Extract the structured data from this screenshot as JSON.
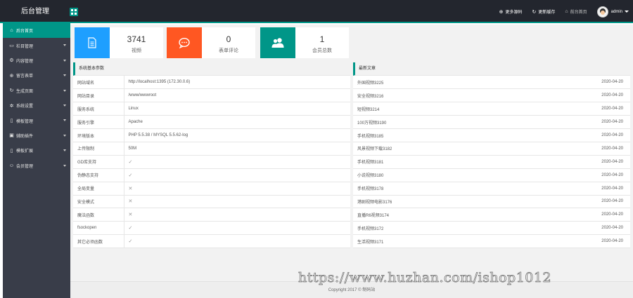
{
  "brand": {
    "title": "后台管理"
  },
  "topbar": {
    "links": [
      {
        "label": "更多源码",
        "icon": "globe-icon"
      },
      {
        "label": "更新缓存",
        "icon": "refresh-icon"
      },
      {
        "label": "前台首页",
        "icon": "home-icon"
      }
    ],
    "user": "admin"
  },
  "sidebar": {
    "items": [
      {
        "label": "后台首页",
        "icon": "home-icon",
        "active": true,
        "arrow": false
      },
      {
        "label": "栏目管理",
        "icon": "monitor-icon",
        "arrow": true
      },
      {
        "label": "内容管理",
        "icon": "settings-icon",
        "arrow": true
      },
      {
        "label": "留言表单",
        "icon": "globe-icon",
        "arrow": true
      },
      {
        "label": "生成页面",
        "icon": "refresh-icon",
        "arrow": true
      },
      {
        "label": "系统设置",
        "icon": "gear-icon",
        "arrow": true
      },
      {
        "label": "模板管理",
        "icon": "template-icon",
        "arrow": true
      },
      {
        "label": "辅助插件",
        "icon": "plugin-icon",
        "arrow": true
      },
      {
        "label": "模板扩展",
        "icon": "extend-icon",
        "arrow": true
      },
      {
        "label": "会员管理",
        "icon": "user-icon",
        "arrow": true
      }
    ]
  },
  "stats": [
    {
      "number": "3741",
      "label": "视频",
      "color": "#1e9fff",
      "icon": "document-icon"
    },
    {
      "number": "0",
      "label": "表单评论",
      "color": "#ff5722",
      "icon": "chat-icon"
    },
    {
      "number": "1",
      "label": "会员总数",
      "color": "#009688",
      "icon": "users-icon"
    }
  ],
  "system": {
    "title": "系统基本参数",
    "rows": [
      {
        "key": "网站域名",
        "value": "http://localhost:1395 (172.30.0.6)"
      },
      {
        "key": "网站目录",
        "value": "/www/wwwroot"
      },
      {
        "key": "服务系统",
        "value": "Linux"
      },
      {
        "key": "服务引擎",
        "value": "Apache"
      },
      {
        "key": "环境版本",
        "value": "PHP 5.5.38 / MYSQL 5.5.62-log"
      },
      {
        "key": "上传限制",
        "value": "50M"
      },
      {
        "key": "GD库支持",
        "value": "✓"
      },
      {
        "key": "伪静态支持",
        "value": "✓"
      },
      {
        "key": "全局变量",
        "value": "✕"
      },
      {
        "key": "安全模式",
        "value": "✕"
      },
      {
        "key": "魔法函数",
        "value": "✕"
      },
      {
        "key": "fsockopen",
        "value": "✓"
      },
      {
        "key": "其它必须函数",
        "value": "✓"
      }
    ]
  },
  "articles": {
    "title": "最新文章",
    "rows": [
      {
        "title": "外国视频3225",
        "date": "2020-04-20"
      },
      {
        "title": "安全视频3216",
        "date": "2020-04-20"
      },
      {
        "title": "短视频3214",
        "date": "2020-04-20"
      },
      {
        "title": "100万视频3190",
        "date": "2020-04-20"
      },
      {
        "title": "手机视频3185",
        "date": "2020-04-20"
      },
      {
        "title": "风景视频下载3182",
        "date": "2020-04-20"
      },
      {
        "title": "手机视频3181",
        "date": "2020-04-20"
      },
      {
        "title": "小说视频3180",
        "date": "2020-04-20"
      },
      {
        "title": "手机视频3178",
        "date": "2020-04-20"
      },
      {
        "title": "港剧视频电影3176",
        "date": "2020-04-20"
      },
      {
        "title": "直播R6视频3174",
        "date": "2020-04-20"
      },
      {
        "title": "手机视频3172",
        "date": "2020-04-20"
      },
      {
        "title": "生活视频3171",
        "date": "2020-04-20"
      }
    ]
  },
  "footer": {
    "text": "Copyright 2017 © 制码站"
  },
  "watermark": {
    "text": "https://www.huzhan.com/ishop1012"
  }
}
